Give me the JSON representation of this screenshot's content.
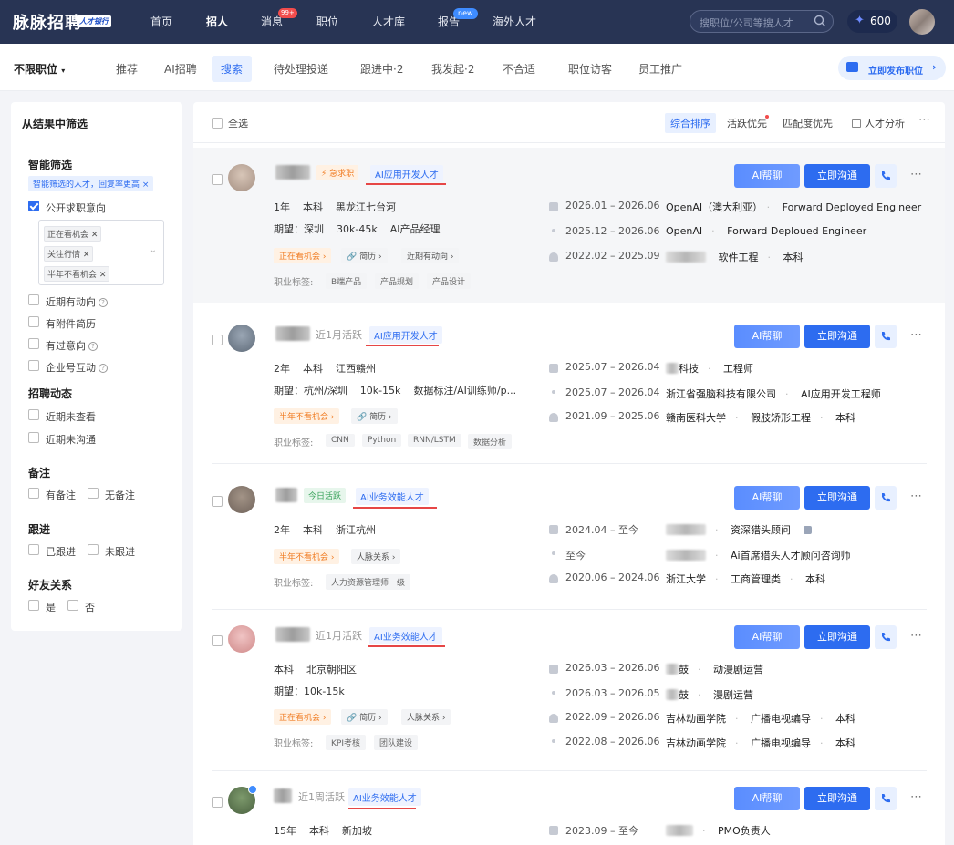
{
  "topbar": {
    "logo": "脉脉招聘",
    "logo_tag": "人才银行",
    "nav": [
      "首页",
      "招人",
      "消息",
      "职位",
      "人才库",
      "报告",
      "海外人才"
    ],
    "msg_badge": "99+",
    "report_badge": "new",
    "search_placeholder": "搜职位/公司等搜人才",
    "coins": "600"
  },
  "subnav": {
    "position_filter": "不限职位",
    "tabs": [
      "推荐",
      "AI招聘",
      "搜索",
      "待处理投递",
      "跟进中·2",
      "我发起·2",
      "不合适",
      "职位访客",
      "员工推广"
    ],
    "publish": "立即发布职位"
  },
  "sidebar": {
    "title": "从结果中筛选",
    "smart_title": "智能筛选",
    "smart_tag": "智能筛选的人才，回复率更高 ×",
    "open_intent": "公开求职意向",
    "chips": [
      "正在看机会",
      "关注行情",
      "半年不看机会"
    ],
    "opt1": "近期有动向",
    "opt2": "有附件简历",
    "opt3": "有过意向",
    "opt4": "企业号互动",
    "dyn_title": "招聘动态",
    "dyn1": "近期未查看",
    "dyn2": "近期未沟通",
    "note_title": "备注",
    "note_yes": "有备注",
    "note_no": "无备注",
    "follow_title": "跟进",
    "follow_yes": "已跟进",
    "follow_no": "未跟进",
    "friend_title": "好友关系",
    "friend_yes": "是",
    "friend_no": "否"
  },
  "toolbar": {
    "select_all": "全选",
    "sort": [
      "综合排序",
      "活跃优先",
      "匹配度优先"
    ],
    "analysis": "人才分析"
  },
  "actions": {
    "ai": "AI帮聊",
    "chat": "立即沟通"
  },
  "cards": [
    {
      "status_pill": "⚡ 急求职",
      "role": "AI应用开发人才",
      "line1": [
        "1年",
        "本科",
        "黑龙江七台河"
      ],
      "line2": [
        "期望：深圳",
        "30k-45k",
        "AI产品经理"
      ],
      "pills": [
        "正在看机会 ›",
        "简历 ›",
        "近期有动向 ›"
      ],
      "tag_label": "职业标签:",
      "tags": [
        "B端产品",
        "产品规划",
        "产品设计"
      ],
      "exp": [
        {
          "date": "2026.01 – 2026.06",
          "org": "OpenAI（澳大利亚）",
          "title": "Forward Deployed Engineer"
        },
        {
          "date": "2025.12 – 2026.06",
          "org": "OpenAI",
          "title": "Forward Deploued Engineer"
        },
        {
          "date": "2022.02 – 2025.09",
          "org": "",
          "title": "软件工程",
          "degree": "本科"
        }
      ]
    },
    {
      "active": "近1月活跃",
      "role": "AI应用开发人才",
      "line1": [
        "2年",
        "本科",
        "江西赣州"
      ],
      "line2": [
        "期望：杭州/深圳",
        "10k-15k",
        "数据标注/AI训练师/p..."
      ],
      "pills": [
        "半年不看机会 ›",
        "简历 ›"
      ],
      "tag_label": "职业标签:",
      "tags": [
        "CNN",
        "Python",
        "RNN/LSTM",
        "数据分析"
      ],
      "exp": [
        {
          "date": "2025.07 – 2026.04",
          "org": "科技",
          "title": "工程师"
        },
        {
          "date": "2025.07 – 2026.04",
          "org": "浙江省强脑科技有限公司",
          "title": "AI应用开发工程师"
        },
        {
          "date": "2021.09 – 2025.06",
          "org": "赣南医科大学",
          "title": "假肢矫形工程",
          "degree": "本科"
        }
      ]
    },
    {
      "active": "今日活跃",
      "role": "AI业务效能人才",
      "line1": [
        "2年",
        "本科",
        "浙江杭州"
      ],
      "pills": [
        "半年不看机会 ›",
        "人脉关系 ›"
      ],
      "tag_label": "职业标签:",
      "tags": [
        "人力资源管理师一级"
      ],
      "exp": [
        {
          "date": "2024.04 – 至今",
          "org": "",
          "title": "资深猎头顾问"
        },
        {
          "date": "至今",
          "org": "",
          "title": "Ai首席猎头人才顾问咨询师"
        },
        {
          "date": "2020.06 – 2024.06",
          "org": "浙江大学",
          "title": "工商管理类",
          "degree": "本科"
        }
      ]
    },
    {
      "active": "近1月活跃",
      "role": "AI业务效能人才",
      "line1": [
        "本科",
        "北京朝阳区"
      ],
      "line2": [
        "期望：10k-15k"
      ],
      "pills": [
        "正在看机会 ›",
        "简历 ›",
        "人脉关系 ›"
      ],
      "tag_label": "职业标签:",
      "tags": [
        "KPI考核",
        "团队建设"
      ],
      "exp": [
        {
          "date": "2026.03 – 2026.06",
          "org": "鼓",
          "title": "动漫剧运营"
        },
        {
          "date": "2026.03 – 2026.05",
          "org": "鼓",
          "title": "漫剧运营"
        },
        {
          "date": "2022.09 – 2026.06",
          "org": "吉林动画学院",
          "title": "广播电视编导",
          "degree": "本科"
        },
        {
          "date": "2022.08 – 2026.06",
          "org": "吉林动画学院",
          "title": "广播电视编导",
          "degree": "本科"
        }
      ]
    },
    {
      "active": "近1周活跃",
      "role": "AI业务效能人才",
      "line1": [
        "15年",
        "本科",
        "新加坡"
      ],
      "exp": [
        {
          "date": "2023.09 – 至今",
          "org": "",
          "title": "PMO负责人"
        }
      ]
    }
  ]
}
